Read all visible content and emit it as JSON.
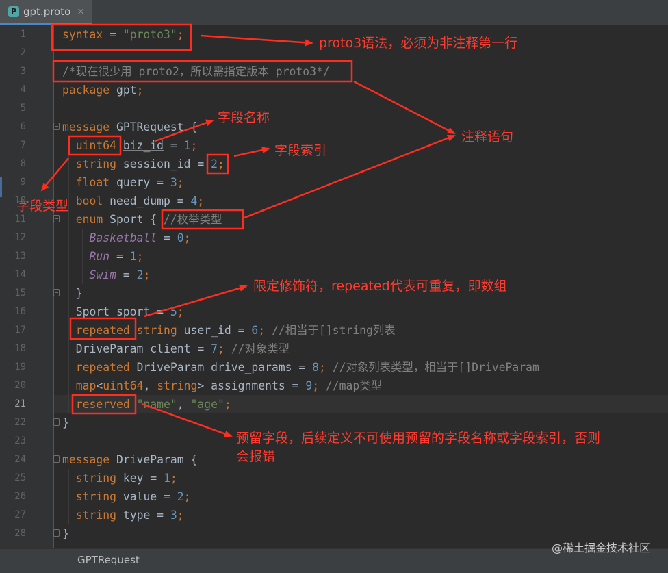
{
  "tab": {
    "icon_letter": "P",
    "filename": "gpt.proto",
    "close": "×"
  },
  "line_numbers": [
    "1",
    "2",
    "3",
    "4",
    "5",
    "6",
    "7",
    "8",
    "9",
    "10",
    "11",
    "12",
    "13",
    "14",
    "15",
    "16",
    "17",
    "18",
    "19",
    "20",
    "21",
    "22",
    "23",
    "24",
    "25",
    "26",
    "27",
    "28"
  ],
  "current_line": "21",
  "code_lines": [
    [
      {
        "t": "syntax",
        "c": "kw"
      },
      {
        "t": " = "
      },
      {
        "t": "\"proto3\"",
        "c": "str"
      },
      {
        "t": ";",
        "c": "kw"
      }
    ],
    [],
    [
      {
        "t": "/*现在很少用 proto2，所以需指定版本 proto3*/",
        "c": "cm"
      }
    ],
    [
      {
        "t": "package",
        "c": "kw"
      },
      {
        "t": " gpt"
      },
      {
        "t": ";",
        "c": "kw"
      }
    ],
    [],
    [
      {
        "t": "message",
        "c": "kw"
      },
      {
        "t": " GPTRequest {"
      }
    ],
    [
      {
        "t": "  "
      },
      {
        "t": "uint64",
        "c": "kw"
      },
      {
        "t": " "
      },
      {
        "t": "biz_id",
        "c": "ul"
      },
      {
        "t": " = "
      },
      {
        "t": "1",
        "c": "num"
      },
      {
        "t": ";",
        "c": "kw"
      }
    ],
    [
      {
        "t": "  "
      },
      {
        "t": "string",
        "c": "kw"
      },
      {
        "t": " session_id = "
      },
      {
        "t": "2",
        "c": "num"
      },
      {
        "t": ";",
        "c": "kw"
      }
    ],
    [
      {
        "t": "  "
      },
      {
        "t": "float",
        "c": "kw"
      },
      {
        "t": " query = "
      },
      {
        "t": "3",
        "c": "num"
      },
      {
        "t": ";",
        "c": "kw"
      }
    ],
    [
      {
        "t": "  "
      },
      {
        "t": "bool",
        "c": "kw"
      },
      {
        "t": " need_dump = "
      },
      {
        "t": "4",
        "c": "num"
      },
      {
        "t": ";",
        "c": "kw"
      }
    ],
    [
      {
        "t": "  "
      },
      {
        "t": "enum",
        "c": "kw"
      },
      {
        "t": " Sport { "
      },
      {
        "t": "//枚举类型",
        "c": "cm"
      }
    ],
    [
      {
        "t": "    "
      },
      {
        "t": "Basketball",
        "c": "en"
      },
      {
        "t": " = "
      },
      {
        "t": "0",
        "c": "num"
      },
      {
        "t": ";",
        "c": "kw"
      }
    ],
    [
      {
        "t": "    "
      },
      {
        "t": "Run",
        "c": "en"
      },
      {
        "t": " = "
      },
      {
        "t": "1",
        "c": "num"
      },
      {
        "t": ";",
        "c": "kw"
      }
    ],
    [
      {
        "t": "    "
      },
      {
        "t": "Swim",
        "c": "en"
      },
      {
        "t": " = "
      },
      {
        "t": "2",
        "c": "num"
      },
      {
        "t": ";",
        "c": "kw"
      }
    ],
    [
      {
        "t": "  }"
      }
    ],
    [
      {
        "t": "  Sport sport = "
      },
      {
        "t": "5",
        "c": "num"
      },
      {
        "t": ";",
        "c": "kw"
      }
    ],
    [
      {
        "t": "  "
      },
      {
        "t": "repeated",
        "c": "kw"
      },
      {
        "t": " "
      },
      {
        "t": "string",
        "c": "kw"
      },
      {
        "t": " user_id = "
      },
      {
        "t": "6",
        "c": "num"
      },
      {
        "t": ";",
        "c": "kw"
      },
      {
        "t": " //相当于[]string列表",
        "c": "cm"
      }
    ],
    [
      {
        "t": "  DriveParam client = "
      },
      {
        "t": "7",
        "c": "num"
      },
      {
        "t": ";",
        "c": "kw"
      },
      {
        "t": " //对象类型",
        "c": "cm"
      }
    ],
    [
      {
        "t": "  "
      },
      {
        "t": "repeated",
        "c": "kw"
      },
      {
        "t": " DriveParam drive_params = "
      },
      {
        "t": "8",
        "c": "num"
      },
      {
        "t": ";",
        "c": "kw"
      },
      {
        "t": " //对象列表类型，相当于[]DriveParam",
        "c": "cm"
      }
    ],
    [
      {
        "t": "  "
      },
      {
        "t": "map",
        "c": "kw"
      },
      {
        "t": "<"
      },
      {
        "t": "uint64",
        "c": "kw"
      },
      {
        "t": ", "
      },
      {
        "t": "string",
        "c": "kw"
      },
      {
        "t": "> assignments = "
      },
      {
        "t": "9",
        "c": "num"
      },
      {
        "t": ";",
        "c": "kw"
      },
      {
        "t": " //map类型",
        "c": "cm"
      }
    ],
    [
      {
        "t": "  "
      },
      {
        "t": "reserved",
        "c": "kw"
      },
      {
        "t": " "
      },
      {
        "t": "\"name\"",
        "c": "str"
      },
      {
        "t": ", "
      },
      {
        "t": "\"age\"",
        "c": "str"
      },
      {
        "t": ";",
        "c": "kw"
      }
    ],
    [
      {
        "t": "}"
      }
    ],
    [],
    [
      {
        "t": "message",
        "c": "kw"
      },
      {
        "t": " DriveParam {"
      }
    ],
    [
      {
        "t": "  "
      },
      {
        "t": "string",
        "c": "kw"
      },
      {
        "t": " key = "
      },
      {
        "t": "1",
        "c": "num"
      },
      {
        "t": ";",
        "c": "kw"
      }
    ],
    [
      {
        "t": "  "
      },
      {
        "t": "string",
        "c": "kw"
      },
      {
        "t": " value = "
      },
      {
        "t": "2",
        "c": "num"
      },
      {
        "t": ";",
        "c": "kw"
      }
    ],
    [
      {
        "t": "  "
      },
      {
        "t": "string",
        "c": "kw"
      },
      {
        "t": " type = "
      },
      {
        "t": "3",
        "c": "num"
      },
      {
        "t": ";",
        "c": "kw"
      }
    ],
    [
      {
        "t": "}"
      }
    ]
  ],
  "annotations": {
    "syntax_note": "proto3语法，必须为非注释第一行",
    "field_name": "字段名称",
    "field_index": "字段索引",
    "comment": "注释语句",
    "field_type": "字段类型",
    "repeated_note": "限定修饰符，repeated代表可重复，即数组",
    "reserved_note_1": "预留字段，后续定义不可使用预留的字段名称或字段索引，否则",
    "reserved_note_2": "会报错"
  },
  "statusbar": {
    "breadcrumb": "GPTRequest"
  },
  "watermark": "@稀土掘金技术社区",
  "colors": {
    "annotation": "#ff2d20",
    "background": "#2b2b2b",
    "keyword": "#cc7832",
    "string": "#6a8759",
    "number": "#6897bb",
    "comment": "#808080",
    "enum_constant": "#9876aa"
  }
}
